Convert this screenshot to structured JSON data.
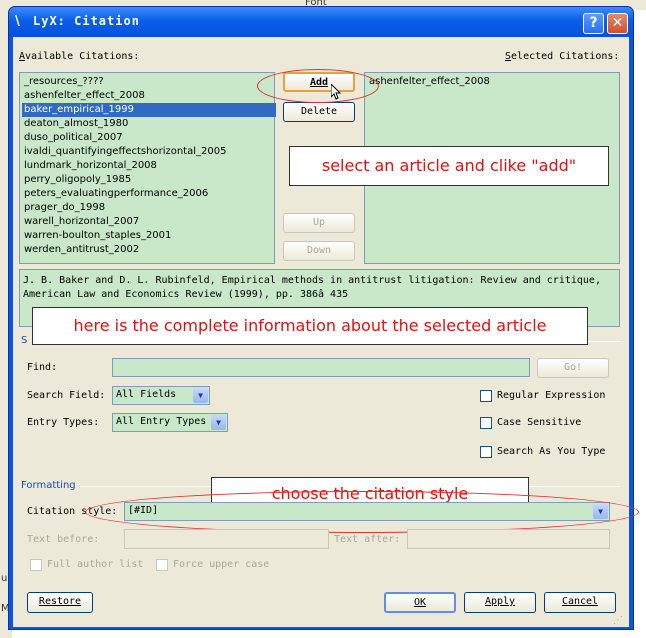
{
  "background": {
    "toolbar_font": "Font",
    "left_letters": [
      "u",
      "M"
    ]
  },
  "window": {
    "title": "LyX: Citation",
    "help_label": "?",
    "close_label": "✕"
  },
  "available": {
    "label_prefix": "",
    "label_underline": "A",
    "label_rest": "vailable Citations:",
    "items": [
      "_resources_????",
      "ashenfelter_effect_2008",
      "baker_empirical_1999",
      "deaton_almost_1980",
      "duso_political_2007",
      "ivaldi_quantifyingeffectshorizontal_2005",
      "lundmark_horizontal_2008",
      "perry_oligopoly_1985",
      "peters_evaluatingperformance_2006",
      "prager_do_1998",
      "warell_horizontal_2007",
      "warren-boulton_staples_2001",
      "werden_antitrust_2002"
    ],
    "selected_index": 2
  },
  "selected": {
    "label_underline": "S",
    "label_rest": "elected Citations:",
    "items": [
      "ashenfelter_effect_2008"
    ]
  },
  "buttons": {
    "add": "Add",
    "delete": "Delete",
    "up": "Up",
    "down": "Down",
    "go": "Go!",
    "restore": "Restore",
    "ok": "OK",
    "apply": "Apply",
    "cancel": "Cancel"
  },
  "info_text": "J. B. Baker and D. L. Rubinfeld, Empirical methods in antitrust litigation: Review and critique, American Law and Economics Review (1999), pp. 386â 435",
  "search": {
    "group_letter": "S",
    "find_label": "Find:",
    "find_value": "",
    "search_field_label": "Search Field:",
    "search_field_value": "All Fields",
    "entry_types_label": "Entry Types:",
    "entry_types_value": "All Entry Types",
    "regular_expression": "Regular Expression",
    "case_sensitive": "Case Sensitive",
    "search_as_you_type": "Search As You Type"
  },
  "formatting": {
    "group_label": "Formatting",
    "citation_style_label": "Citation style:",
    "citation_style_value": "[#ID]",
    "text_before_label": "Text before:",
    "text_after_label": "Text after:",
    "full_author_list": "Full author list",
    "force_upper_case": "Force upper case"
  },
  "annotations": {
    "add_hint": "select  an article and clike \"add\"",
    "info_hint": "here is the complete information about the selected article",
    "style_hint": "choose the citation style"
  },
  "colors": {
    "titlebar": "#0a5fe8",
    "list_bg": "#c9e8c9",
    "selection": "#316ac5",
    "annotation_text": "#e01010",
    "annotation_circle": "#e03030"
  }
}
